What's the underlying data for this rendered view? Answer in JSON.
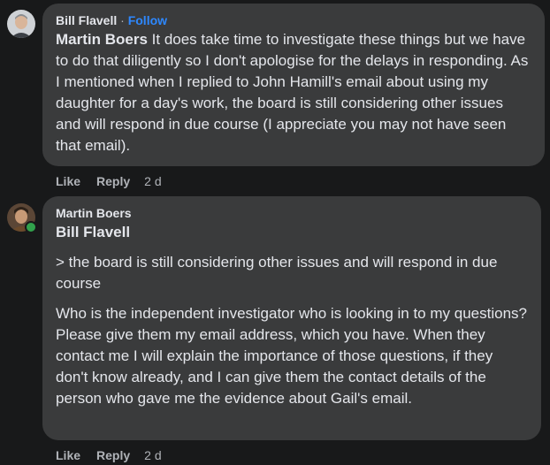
{
  "comments": [
    {
      "author": "Bill Flavell",
      "separator": " · ",
      "follow_label": "Follow",
      "mention": "Martin Boers",
      "text": " It does take time to investigate these things but we have to do that diligently so I don't apologise for the delays in responding. As I mentioned when I replied to John Hamill's email about using my daughter for a day's work, the board is still considering other issues and will respond in due course (I appreciate you may not have seen that email).",
      "like_label": "Like",
      "reply_label": "Reply",
      "time": "2 d"
    },
    {
      "author": "Martin Boers",
      "mention": "Bill Flavell",
      "quote": "> the board is still considering other issues and will respond in due course",
      "text": "Who is the independent investigator who is looking in to my questions? Please give them my email address, which you have. When they contact me I will explain the importance of those questions, if they don't know already, and I can give them the contact details of the person who gave me the evidence about Gail's email.",
      "like_label": "Like",
      "reply_label": "Reply",
      "time": "2 d"
    }
  ],
  "colors": {
    "background": "#18191a",
    "bubble": "#3a3b3c",
    "text": "#e4e6eb",
    "secondary_text": "#b0b3b8",
    "link": "#2d88ff",
    "online": "#31a24c"
  }
}
